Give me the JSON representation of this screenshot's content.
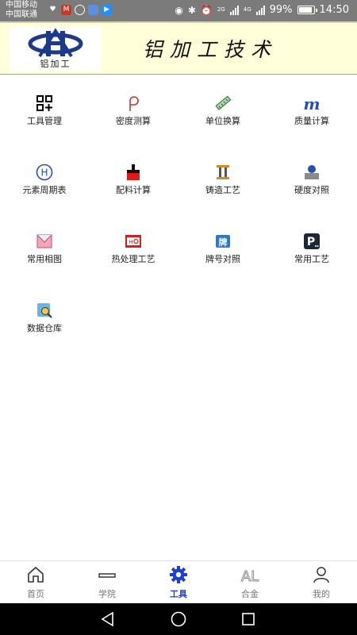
{
  "status_bar": {
    "carrier_1": "中国移动",
    "carrier_2": "中国联通",
    "battery": "99%",
    "time": "14:50",
    "network_1": "2G",
    "network_2": "4G",
    "battery_level": 0.99
  },
  "header": {
    "logo_text": "铝加工",
    "title": "铝加工技术"
  },
  "tools": [
    {
      "label": "工具管理",
      "icon": "tool-grid-icon"
    },
    {
      "label": "密度测算",
      "icon": "rho-icon"
    },
    {
      "label": "单位换算",
      "icon": "ruler-icon"
    },
    {
      "label": "质量计算",
      "icon": "mass-m-icon"
    },
    {
      "label": "元素周期表",
      "icon": "hydrogen-icon"
    },
    {
      "label": "配料计算",
      "icon": "crucible-icon"
    },
    {
      "label": "铸造工艺",
      "icon": "casting-icon"
    },
    {
      "label": "硬度对照",
      "icon": "hardness-icon"
    },
    {
      "label": "常用相图",
      "icon": "phase-diagram-icon"
    },
    {
      "label": "热处理工艺",
      "icon": "heat-treat-icon"
    },
    {
      "label": "牌号对照",
      "icon": "grade-compare-icon"
    },
    {
      "label": "常用工艺",
      "icon": "process-p-icon"
    },
    {
      "label": "数据仓库",
      "icon": "database-icon"
    }
  ],
  "bottom_nav": [
    {
      "label": "首页",
      "icon": "home-icon",
      "active": false
    },
    {
      "label": "学院",
      "icon": "academy-icon",
      "active": false
    },
    {
      "label": "工具",
      "icon": "gear-icon",
      "active": true
    },
    {
      "label": "合金",
      "icon": "alloy-al-icon",
      "active": false
    },
    {
      "label": "我的",
      "icon": "profile-icon",
      "active": false
    }
  ],
  "colors": {
    "active": "#1e3fd6",
    "banner_bg": "#ffffd9",
    "statusbar_bg": "#7b7b7b"
  }
}
